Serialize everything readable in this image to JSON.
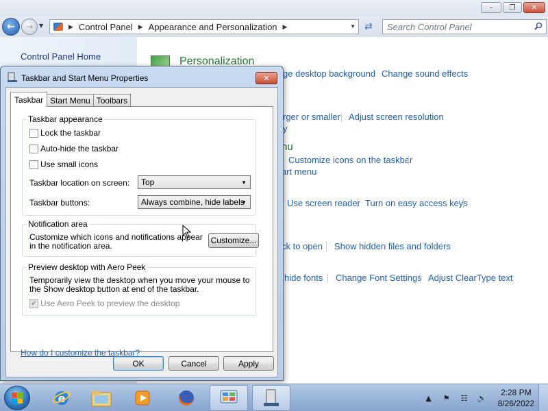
{
  "control_panel": {
    "breadcrumb": [
      "Control Panel",
      "Appearance and Personalization"
    ],
    "search_placeholder": "Search Control Panel",
    "sidebar_home": "Control Panel Home",
    "personalization_heading": "Personalization",
    "links": {
      "change_desktop_background": "ge desktop background",
      "change_sound_effects": "Change sound effects",
      "larger_or_smaller": "rger or smaller",
      "adjust_screen_resolution": "Adjust screen resolution",
      "y_fragment": "y",
      "nu_fragment": "nu",
      "customize_icons_taskbar": "Customize icons on the taskbar",
      "art_menu": "art menu",
      "use_screen_reader": "Use screen reader",
      "turn_on_easy_access_keys": "Turn on easy access keys",
      "ck_to_open": "ck to open",
      "show_hidden_files": "Show hidden files and folders",
      "hide_fonts": "hide fonts",
      "change_font_settings": "Change Font Settings",
      "adjust_cleartype": "Adjust ClearType text"
    }
  },
  "dialog": {
    "title": "Taskbar and Start Menu Properties",
    "tabs": [
      {
        "label": "Taskbar",
        "active": true
      },
      {
        "label": "Start Menu",
        "active": false
      },
      {
        "label": "Toolbars",
        "active": false
      }
    ],
    "appearance": {
      "label": "Taskbar appearance",
      "lock": {
        "label": "Lock the taskbar",
        "checked": false
      },
      "autohide": {
        "label": "Auto-hide the taskbar",
        "checked": false
      },
      "small_icons": {
        "label": "Use small icons",
        "checked": false
      },
      "location_label": "Taskbar location on screen:",
      "location_value": "Top",
      "buttons_label": "Taskbar buttons:",
      "buttons_value": "Always combine, hide labels"
    },
    "notification": {
      "label": "Notification area",
      "text": "Customize which icons and notifications appear in the notification area.",
      "customize_button": "Customize..."
    },
    "aero_peek": {
      "label": "Preview desktop with Aero Peek",
      "text": "Temporarily view the desktop when you move your mouse to the Show desktop button at end of the taskbar.",
      "checkbox_label": "Use Aero Peek to preview the desktop",
      "checked": true,
      "enabled": false
    },
    "help_link": "How do I customize the taskbar?",
    "buttons": {
      "ok": "OK",
      "cancel": "Cancel",
      "apply": "Apply"
    }
  },
  "taskbar": {
    "pinned": [
      "internet-explorer-icon",
      "windows-explorer-icon",
      "media-player-icon",
      "firefox-icon",
      "control-panel-icon",
      "taskbar-properties-icon"
    ],
    "clock_time": "2:28 PM",
    "clock_date": "8/26/2022"
  },
  "colors": {
    "link_blue": "#1f5fb3",
    "heading_green": "#1e7a2f",
    "taskbar": "#9db7da"
  }
}
